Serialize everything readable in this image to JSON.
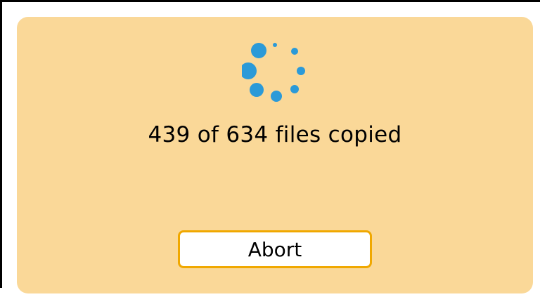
{
  "dialog": {
    "progress_text": "439 of 634 files copied",
    "abort_label": "Abort",
    "spinner_icon": "loading-spinner-icon"
  },
  "colors": {
    "dialog_background": "#fad898",
    "spinner": "#2b9ad8",
    "button_border": "#f0a800",
    "button_background": "#ffffff"
  }
}
